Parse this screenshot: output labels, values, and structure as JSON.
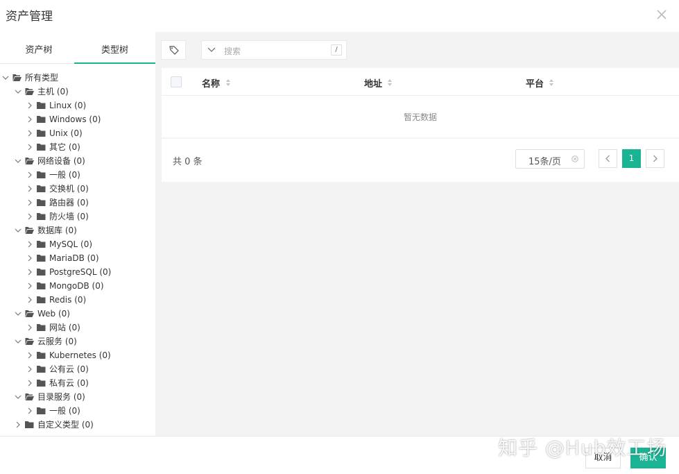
{
  "dialog": {
    "title": "资产管理"
  },
  "tabs": [
    {
      "label": "资产树"
    },
    {
      "label": "类型树"
    }
  ],
  "tree": [
    {
      "label": "所有类型",
      "depth": 0,
      "chev": "down",
      "folder": "open"
    },
    {
      "label": "主机 (0)",
      "depth": 1,
      "chev": "down",
      "folder": "open"
    },
    {
      "label": "Linux (0)",
      "depth": 2,
      "chev": "right",
      "folder": "closed"
    },
    {
      "label": "Windows (0)",
      "depth": 2,
      "chev": "right",
      "folder": "closed"
    },
    {
      "label": "Unix (0)",
      "depth": 2,
      "chev": "right",
      "folder": "closed"
    },
    {
      "label": "其它 (0)",
      "depth": 2,
      "chev": "right",
      "folder": "closed"
    },
    {
      "label": "网络设备 (0)",
      "depth": 1,
      "chev": "down",
      "folder": "open"
    },
    {
      "label": "一般 (0)",
      "depth": 2,
      "chev": "right",
      "folder": "closed"
    },
    {
      "label": "交换机 (0)",
      "depth": 2,
      "chev": "right",
      "folder": "closed"
    },
    {
      "label": "路由器 (0)",
      "depth": 2,
      "chev": "right",
      "folder": "closed"
    },
    {
      "label": "防火墙 (0)",
      "depth": 2,
      "chev": "right",
      "folder": "closed"
    },
    {
      "label": "数据库 (0)",
      "depth": 1,
      "chev": "down",
      "folder": "open"
    },
    {
      "label": "MySQL (0)",
      "depth": 2,
      "chev": "right",
      "folder": "closed"
    },
    {
      "label": "MariaDB (0)",
      "depth": 2,
      "chev": "right",
      "folder": "closed"
    },
    {
      "label": "PostgreSQL (0)",
      "depth": 2,
      "chev": "right",
      "folder": "closed"
    },
    {
      "label": "MongoDB (0)",
      "depth": 2,
      "chev": "right",
      "folder": "closed"
    },
    {
      "label": "Redis (0)",
      "depth": 2,
      "chev": "right",
      "folder": "closed"
    },
    {
      "label": "Web (0)",
      "depth": 1,
      "chev": "down",
      "folder": "open"
    },
    {
      "label": "网站 (0)",
      "depth": 2,
      "chev": "right",
      "folder": "closed"
    },
    {
      "label": "云服务 (0)",
      "depth": 1,
      "chev": "down",
      "folder": "open"
    },
    {
      "label": "Kubernetes (0)",
      "depth": 2,
      "chev": "right",
      "folder": "closed"
    },
    {
      "label": "公有云 (0)",
      "depth": 2,
      "chev": "right",
      "folder": "closed"
    },
    {
      "label": "私有云 (0)",
      "depth": 2,
      "chev": "right",
      "folder": "closed"
    },
    {
      "label": "目录服务 (0)",
      "depth": 1,
      "chev": "down",
      "folder": "open"
    },
    {
      "label": "一般 (0)",
      "depth": 2,
      "chev": "right",
      "folder": "closed"
    },
    {
      "label": "自定义类型 (0)",
      "depth": 1,
      "chev": "right",
      "folder": "closed"
    }
  ],
  "search": {
    "placeholder": "搜索",
    "shortcut": "/"
  },
  "table": {
    "columns": [
      {
        "label": "名称"
      },
      {
        "label": "地址"
      },
      {
        "label": "平台"
      }
    ],
    "empty_text": "暂无数据"
  },
  "pagination": {
    "total_text": "共 0 条",
    "page_size": "15条/页",
    "current_page": "1"
  },
  "footer": {
    "cancel": "取消",
    "confirm": "确认"
  },
  "watermark": {
    "text": "知乎 @Hub效工场"
  },
  "colors": {
    "accent": "#1ab394",
    "panel_bg": "#f3f3f4"
  }
}
